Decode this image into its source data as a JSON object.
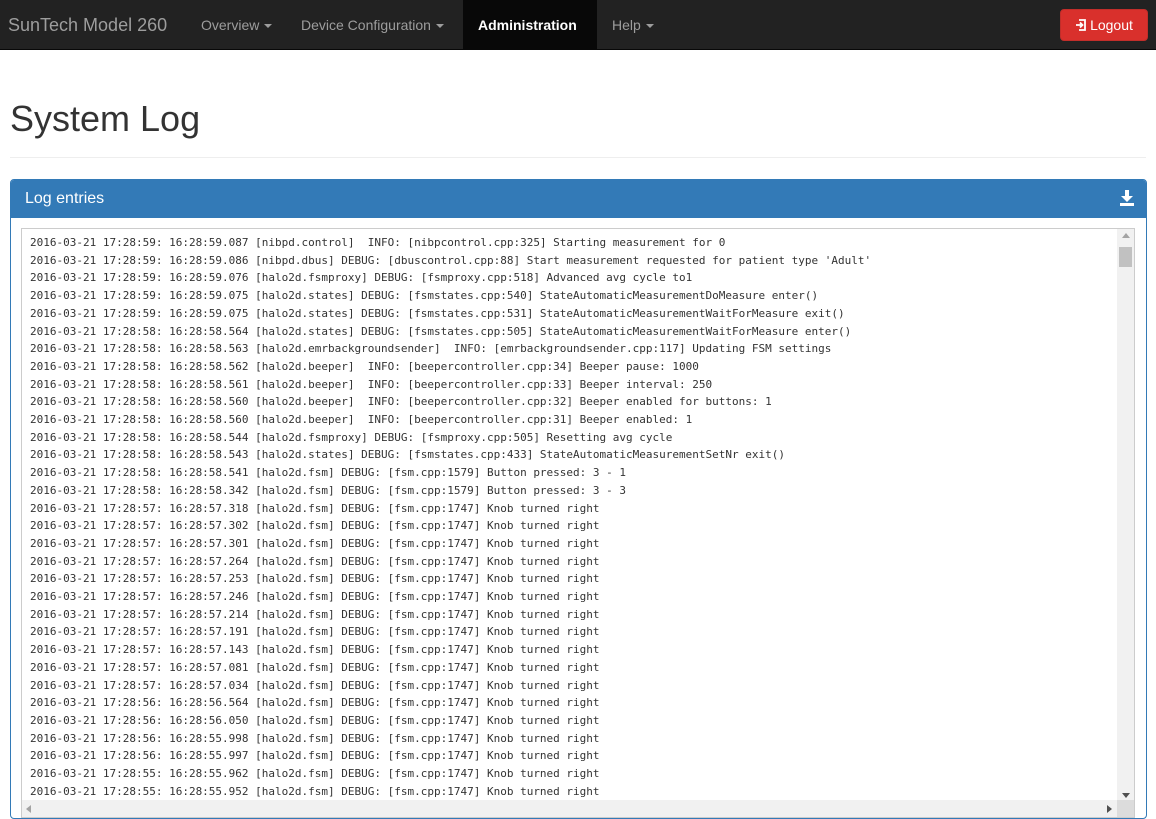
{
  "navbar": {
    "brand": "SunTech Model 260",
    "items": [
      {
        "label": "Overview"
      },
      {
        "label": "Device Configuration"
      },
      {
        "label": "Administration"
      },
      {
        "label": "Help"
      }
    ],
    "logout_label": "Logout",
    "logout_icon": "logout-icon"
  },
  "page": {
    "title": "System Log"
  },
  "panel": {
    "title": "Log entries",
    "download_icon": "download-icon"
  },
  "colors": {
    "navbar": "#222222",
    "panel_primary": "#337ab7",
    "danger": "#d9302c"
  },
  "log": {
    "lines": [
      "2016-03-21 17:28:59: 16:28:59.087 [nibpd.control]  INFO: [nibpcontrol.cpp:325] Starting measurement for 0",
      "2016-03-21 17:28:59: 16:28:59.086 [nibpd.dbus] DEBUG: [dbuscontrol.cpp:88] Start measurement requested for patient type 'Adult'",
      "2016-03-21 17:28:59: 16:28:59.076 [halo2d.fsmproxy] DEBUG: [fsmproxy.cpp:518] Advanced avg cycle to1",
      "2016-03-21 17:28:59: 16:28:59.075 [halo2d.states] DEBUG: [fsmstates.cpp:540] StateAutomaticMeasurementDoMeasure enter()",
      "2016-03-21 17:28:59: 16:28:59.075 [halo2d.states] DEBUG: [fsmstates.cpp:531] StateAutomaticMeasurementWaitForMeasure exit()",
      "2016-03-21 17:28:58: 16:28:58.564 [halo2d.states] DEBUG: [fsmstates.cpp:505] StateAutomaticMeasurementWaitForMeasure enter()",
      "2016-03-21 17:28:58: 16:28:58.563 [halo2d.emrbackgroundsender]  INFO: [emrbackgroundsender.cpp:117] Updating FSM settings",
      "2016-03-21 17:28:58: 16:28:58.562 [halo2d.beeper]  INFO: [beepercontroller.cpp:34] Beeper pause: 1000",
      "2016-03-21 17:28:58: 16:28:58.561 [halo2d.beeper]  INFO: [beepercontroller.cpp:33] Beeper interval: 250",
      "2016-03-21 17:28:58: 16:28:58.560 [halo2d.beeper]  INFO: [beepercontroller.cpp:32] Beeper enabled for buttons: 1",
      "2016-03-21 17:28:58: 16:28:58.560 [halo2d.beeper]  INFO: [beepercontroller.cpp:31] Beeper enabled: 1",
      "2016-03-21 17:28:58: 16:28:58.544 [halo2d.fsmproxy] DEBUG: [fsmproxy.cpp:505] Resetting avg cycle",
      "2016-03-21 17:28:58: 16:28:58.543 [halo2d.states] DEBUG: [fsmstates.cpp:433] StateAutomaticMeasurementSetNr exit()",
      "2016-03-21 17:28:58: 16:28:58.541 [halo2d.fsm] DEBUG: [fsm.cpp:1579] Button pressed: 3 - 1",
      "2016-03-21 17:28:58: 16:28:58.342 [halo2d.fsm] DEBUG: [fsm.cpp:1579] Button pressed: 3 - 3",
      "2016-03-21 17:28:57: 16:28:57.318 [halo2d.fsm] DEBUG: [fsm.cpp:1747] Knob turned right",
      "2016-03-21 17:28:57: 16:28:57.302 [halo2d.fsm] DEBUG: [fsm.cpp:1747] Knob turned right",
      "2016-03-21 17:28:57: 16:28:57.301 [halo2d.fsm] DEBUG: [fsm.cpp:1747] Knob turned right",
      "2016-03-21 17:28:57: 16:28:57.264 [halo2d.fsm] DEBUG: [fsm.cpp:1747] Knob turned right",
      "2016-03-21 17:28:57: 16:28:57.253 [halo2d.fsm] DEBUG: [fsm.cpp:1747] Knob turned right",
      "2016-03-21 17:28:57: 16:28:57.246 [halo2d.fsm] DEBUG: [fsm.cpp:1747] Knob turned right",
      "2016-03-21 17:28:57: 16:28:57.214 [halo2d.fsm] DEBUG: [fsm.cpp:1747] Knob turned right",
      "2016-03-21 17:28:57: 16:28:57.191 [halo2d.fsm] DEBUG: [fsm.cpp:1747] Knob turned right",
      "2016-03-21 17:28:57: 16:28:57.143 [halo2d.fsm] DEBUG: [fsm.cpp:1747] Knob turned right",
      "2016-03-21 17:28:57: 16:28:57.081 [halo2d.fsm] DEBUG: [fsm.cpp:1747] Knob turned right",
      "2016-03-21 17:28:57: 16:28:57.034 [halo2d.fsm] DEBUG: [fsm.cpp:1747] Knob turned right",
      "2016-03-21 17:28:56: 16:28:56.564 [halo2d.fsm] DEBUG: [fsm.cpp:1747] Knob turned right",
      "2016-03-21 17:28:56: 16:28:56.050 [halo2d.fsm] DEBUG: [fsm.cpp:1747] Knob turned right",
      "2016-03-21 17:28:56: 16:28:55.998 [halo2d.fsm] DEBUG: [fsm.cpp:1747] Knob turned right",
      "2016-03-21 17:28:56: 16:28:55.997 [halo2d.fsm] DEBUG: [fsm.cpp:1747] Knob turned right",
      "2016-03-21 17:28:55: 16:28:55.962 [halo2d.fsm] DEBUG: [fsm.cpp:1747] Knob turned right",
      "2016-03-21 17:28:55: 16:28:55.952 [halo2d.fsm] DEBUG: [fsm.cpp:1747] Knob turned right"
    ]
  }
}
